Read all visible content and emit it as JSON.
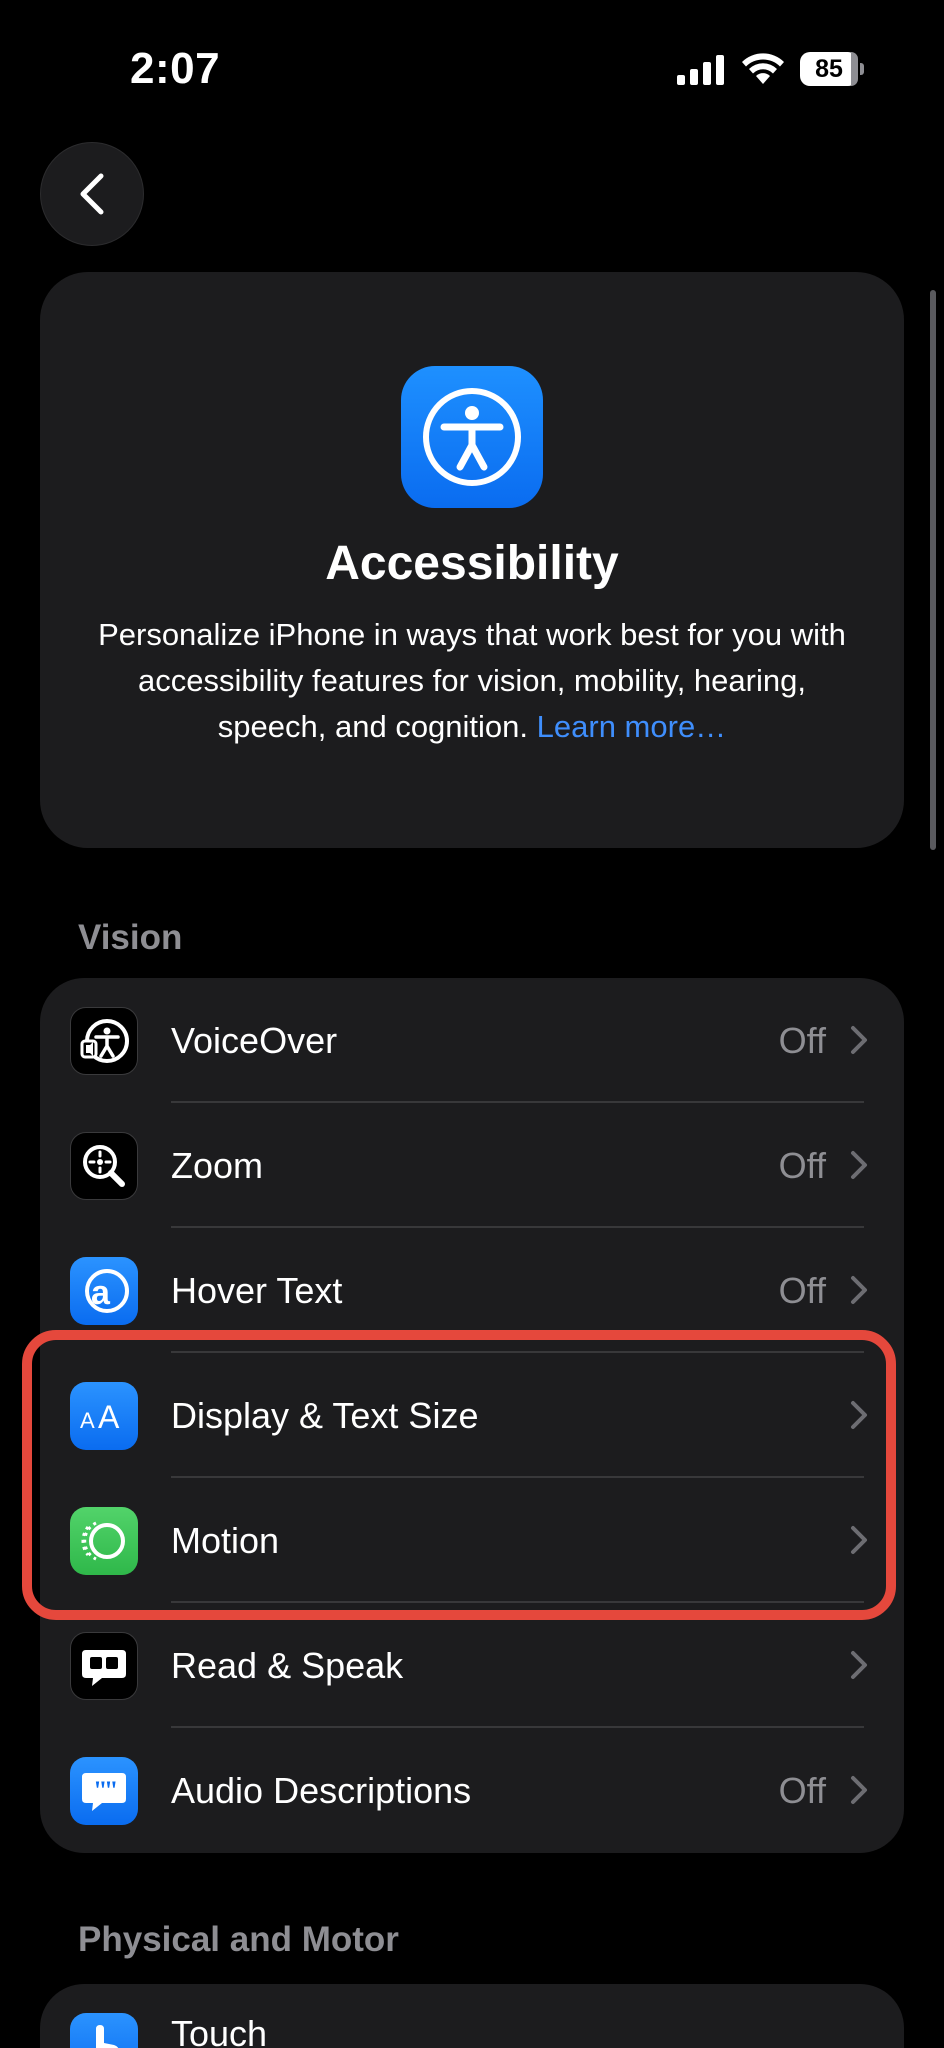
{
  "status_bar": {
    "time": "2:07",
    "battery": "85"
  },
  "header": {
    "title": "Accessibility",
    "description": "Personalize iPhone in ways that work best for you with accessibility features for vision, mobility, hearing, speech, and cognition.",
    "learn_more": "Learn more…"
  },
  "sections": {
    "vision": {
      "title": "Vision",
      "items": [
        {
          "label": "VoiceOver",
          "value": "Off",
          "icon": "voiceover-icon"
        },
        {
          "label": "Zoom",
          "value": "Off",
          "icon": "zoom-icon"
        },
        {
          "label": "Hover Text",
          "value": "Off",
          "icon": "hover-text-icon"
        },
        {
          "label": "Display & Text Size",
          "value": "",
          "icon": "display-text-size-icon"
        },
        {
          "label": "Motion",
          "value": "",
          "icon": "motion-icon"
        },
        {
          "label": "Read & Speak",
          "value": "",
          "icon": "read-speak-icon"
        },
        {
          "label": "Audio Descriptions",
          "value": "Off",
          "icon": "audio-descriptions-icon"
        }
      ]
    },
    "physical": {
      "title": "Physical and Motor",
      "items": [
        {
          "label": "Touch",
          "value": "",
          "icon": "touch-icon"
        }
      ]
    }
  },
  "colors": {
    "highlight": "#e5483c",
    "accent": "#3f8efc",
    "background": "#000000",
    "card": "#1c1c1e"
  }
}
